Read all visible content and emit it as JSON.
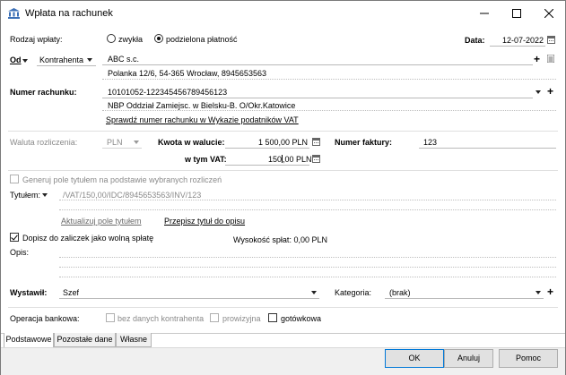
{
  "window": {
    "title": "Wpłata na rachunek",
    "minimize_icon": "minimize-icon",
    "maximize_icon": "maximize-icon",
    "close_icon": "close-icon"
  },
  "form": {
    "rodzaj_label": "Rodzaj wpłaty:",
    "rodzaj_opt1": "zwykła",
    "rodzaj_opt2": "podzielona płatność",
    "rodzaj_selected": "podzielona płatność",
    "data_label": "Data:",
    "data_value": "12-07-2022",
    "od_label": "Od",
    "od_type": "Kontrahenta",
    "contractor_name": "ABC s.c.",
    "contractor_address": "Polanka  12/6, 54-365 Wrocław, 8945653563",
    "numer_label": "Numer rachunku:",
    "numer_value": "10101052-122345456789456123",
    "bank_name": "NBP Oddział Zamiejsc. w Bielsku-B.  O/Okr.Katowice",
    "verify_link": "Sprawdź numer rachunku w Wykazie podatników VAT",
    "waluta_label": "Waluta rozliczenia:",
    "waluta_value": "PLN",
    "kwota_label": "Kwota w walucie:",
    "kwota_value": "1 500,00 PLN",
    "vat_label": "w tym VAT:",
    "vat_value_a": "150",
    "vat_value_b": ",00 PLN",
    "faktura_label": "Numer faktury:",
    "faktura_value": "123",
    "generuj_label": "Generuj pole tytułem na podstawie wybranych rozliczeń",
    "tytulem_label": "Tytułem:",
    "tytulem_value": "/VAT/150,00/IDC/8945653563/INV/123",
    "aktualizuj_link": "Aktualizuj pole tytułem",
    "przepisz_link": "Przepisz tytuł do opisu",
    "dopisz_label": "Dopisz do zaliczek jako wolną spłatę",
    "wysokosc_label": "Wysokość spłat: 0,00 PLN",
    "opis_label": "Opis:",
    "wystawil_label": "Wystawił:",
    "wystawil_value": "Szef",
    "kategoria_label": "Kategoria:",
    "kategoria_value": "(brak)",
    "operacja_label": "Operacja bankowa:",
    "op_opt1": "bez danych kontrahenta",
    "op_opt2": "prowizyjna",
    "op_opt3": "gotówkowa"
  },
  "tabs": [
    "Podstawowe",
    "Pozostałe dane",
    "Własne"
  ],
  "buttons": {
    "ok": "OK",
    "cancel": "Anuluj",
    "help": "Pomoc"
  }
}
